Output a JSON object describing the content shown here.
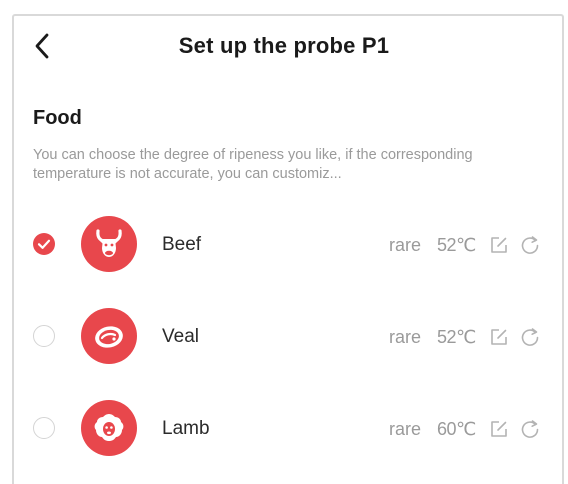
{
  "header": {
    "title": "Set up the probe P1",
    "back_icon": "chevron-left-icon"
  },
  "food_section": {
    "title": "Food",
    "description": "You can choose the degree of ripeness you like, if the corresponding temperature is not accurate, you can customiz..."
  },
  "food_items": [
    {
      "name": "Beef",
      "icon": "beef-icon",
      "selected": true,
      "doneness": "rare",
      "temperature": "52℃"
    },
    {
      "name": "Veal",
      "icon": "veal-icon",
      "selected": false,
      "doneness": "rare",
      "temperature": "52℃"
    },
    {
      "name": "Lamb",
      "icon": "lamb-icon",
      "selected": false,
      "doneness": "rare",
      "temperature": "60℃"
    }
  ],
  "colors": {
    "accent": "#e8474c",
    "text_primary": "#1a1a1a",
    "text_secondary": "#9a9a9a",
    "border": "#d9d9d9"
  }
}
